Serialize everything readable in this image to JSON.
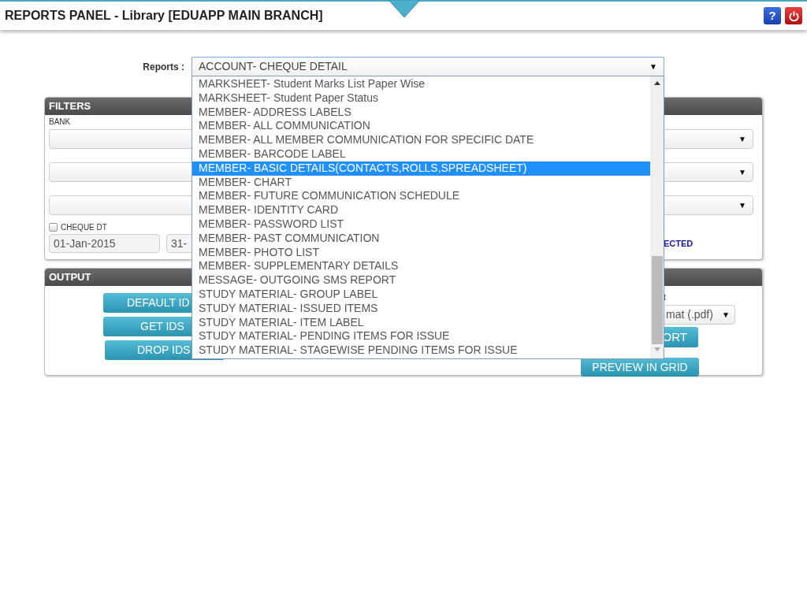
{
  "header": {
    "title": "REPORTS PANEL - Library [EDUAPP MAIN BRANCH]",
    "help": "?"
  },
  "reports": {
    "label": "Reports :",
    "value": "ACCOUNT- CHEQUE DETAIL",
    "arrow": "▼",
    "options": [
      {
        "label": "MARKSHEET- Student Marks List Paper Wise",
        "selected": false
      },
      {
        "label": "MARKSHEET- Student Paper Status",
        "selected": false
      },
      {
        "label": "MEMBER- ADDRESS LABELS",
        "selected": false
      },
      {
        "label": "MEMBER- ALL COMMUNICATION",
        "selected": false
      },
      {
        "label": "MEMBER- ALL MEMBER COMMUNICATION FOR SPECIFIC DATE",
        "selected": false
      },
      {
        "label": "MEMBER- BARCODE LABEL",
        "selected": false
      },
      {
        "label": "MEMBER- BASIC DETAILS(CONTACTS,ROLLS,SPREADSHEET)",
        "selected": true
      },
      {
        "label": "MEMBER- CHART",
        "selected": false
      },
      {
        "label": "MEMBER- FUTURE COMMUNICATION SCHEDULE",
        "selected": false
      },
      {
        "label": "MEMBER- IDENTITY CARD",
        "selected": false
      },
      {
        "label": "MEMBER- PASSWORD LIST",
        "selected": false
      },
      {
        "label": "MEMBER- PAST COMMUNICATION",
        "selected": false
      },
      {
        "label": "MEMBER- PHOTO LIST",
        "selected": false
      },
      {
        "label": "MEMBER- SUPPLEMENTARY DETAILS",
        "selected": false
      },
      {
        "label": "MESSAGE- OUTGOING SMS REPORT",
        "selected": false
      },
      {
        "label": "STUDY MATERIAL- GROUP LABEL",
        "selected": false
      },
      {
        "label": "STUDY MATERIAL- ISSUED ITEMS",
        "selected": false
      },
      {
        "label": "STUDY MATERIAL- ITEM LABEL",
        "selected": false
      },
      {
        "label": "STUDY MATERIAL- PENDING ITEMS FOR ISSUE",
        "selected": false
      },
      {
        "label": "STUDY MATERIAL- STAGEWISE PENDING ITEMS FOR ISSUE",
        "selected": false
      }
    ]
  },
  "filters": {
    "title": "FILTERS",
    "bank_label": "BANK",
    "selects": [
      {
        "arrow": "▼"
      },
      {
        "arrow": "▼"
      },
      {
        "arrow": "▼"
      }
    ],
    "cheque_dt": {
      "label": "CHEQUE DT",
      "checked": false
    },
    "from_date": "01-Jan-2015",
    "to_date": "31-",
    "note": "ECTED"
  },
  "output": {
    "title": "OUTPUT",
    "buttons": [
      "DEFAULT ID",
      "GET IDS",
      "DROP IDS"
    ],
    "format_label": "t",
    "format_value": "mat (.pdf)",
    "format_arrow": "▼",
    "export_button": "ORT",
    "preview_button": "PREVIEW IN GRID"
  }
}
